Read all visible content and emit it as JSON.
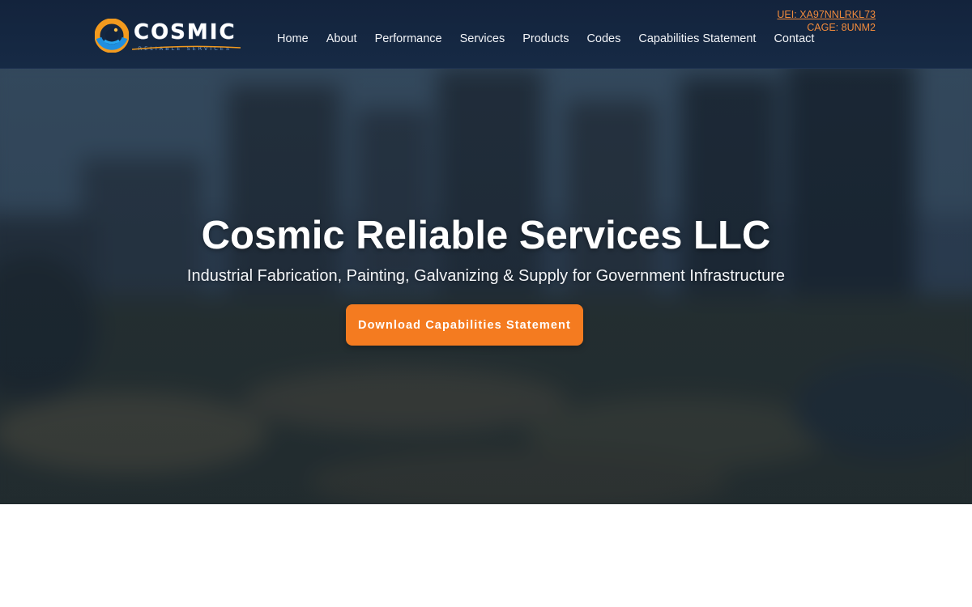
{
  "brand": {
    "name": "COSMIC",
    "tagline": "RELIABLE SERVICES",
    "colors": {
      "navy": "#13233c",
      "orange": "#f47b20",
      "blue": "#1e88e5"
    }
  },
  "nav": {
    "items": [
      {
        "label": "Home"
      },
      {
        "label": "About"
      },
      {
        "label": "Performance"
      },
      {
        "label": "Services"
      },
      {
        "label": "Products"
      },
      {
        "label": "Codes"
      },
      {
        "label": "Capabilities Statement"
      },
      {
        "label": "Contact"
      }
    ]
  },
  "identifiers": {
    "uei": "UEI: XA97NNLRKL73",
    "cage": "CAGE: 8UNM2"
  },
  "hero": {
    "title": "Cosmic Reliable Services LLC",
    "subtitle": "Industrial Fabrication, Painting, Galvanizing & Supply for Government Infrastructure",
    "cta_label": "Download Capabilities Statement"
  }
}
